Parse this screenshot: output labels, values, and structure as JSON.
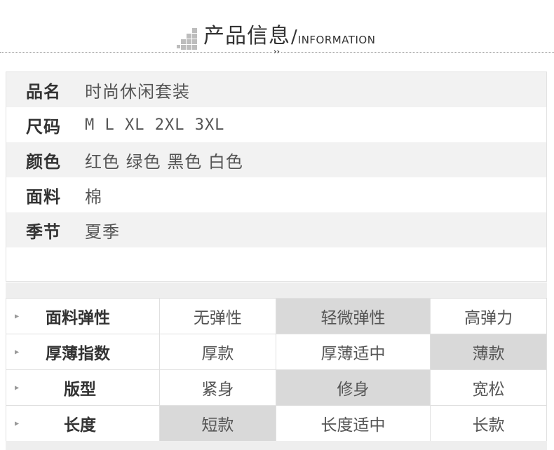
{
  "header": {
    "title_cn": "产品信息",
    "slash": "/",
    "title_en": "INFORMATION",
    "chevron": "››"
  },
  "info": [
    {
      "label": "品名",
      "value": "时尚休闲套装"
    },
    {
      "label": "尺码",
      "value": "M L XL 2XL 3XL"
    },
    {
      "label": "颜色",
      "value": "红色 绿色 黑色 白色"
    },
    {
      "label": "面料",
      "value": "棉"
    },
    {
      "label": "季节",
      "value": "夏季"
    }
  ],
  "properties": [
    {
      "label": "面料弹性",
      "options": [
        "无弹性",
        "轻微弹性",
        "高弹力"
      ],
      "selected": 1
    },
    {
      "label": "厚薄指数",
      "options": [
        "厚款",
        "厚薄适中",
        "薄款"
      ],
      "selected": 2
    },
    {
      "label": "版型",
      "options": [
        "紧身",
        "修身",
        "宽松"
      ],
      "selected": 1
    },
    {
      "label": "长度",
      "options": [
        "短款",
        "长度适中",
        "长款"
      ],
      "selected": 0
    }
  ],
  "colors": {
    "selected_bg": "#d9d9d9",
    "shade_bg": "#f2f2f2"
  }
}
